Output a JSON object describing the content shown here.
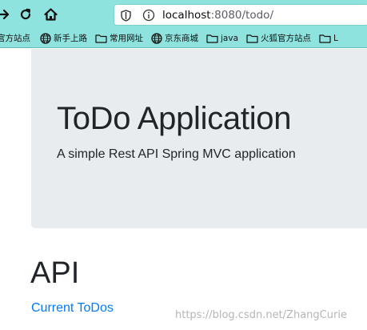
{
  "browser": {
    "url_host": "localhost",
    "url_rest": ":8080/todo/",
    "bookmarks": [
      {
        "label": "官方站点",
        "icon": "globe-icon"
      },
      {
        "label": "新手上路",
        "icon": "globe-icon"
      },
      {
        "label": "常用网址",
        "icon": "folder-icon"
      },
      {
        "label": "京东商城",
        "icon": "globe-icon"
      },
      {
        "label": "java",
        "icon": "folder-icon"
      },
      {
        "label": "火狐官方站点",
        "icon": "folder-icon"
      },
      {
        "label": "L",
        "icon": "folder-icon"
      }
    ]
  },
  "page": {
    "title": "ToDo Application",
    "lead": "A simple Rest API Spring MVC application",
    "api_heading": "API",
    "current_todos_link": "Current ToDos"
  },
  "watermark": "https://blog.csdn.net/ZhangCurie",
  "colors": {
    "toolbar_bg": "#8fe3df",
    "jumbotron_bg": "#e9ecef",
    "link": "#007bff",
    "text": "#212529"
  }
}
